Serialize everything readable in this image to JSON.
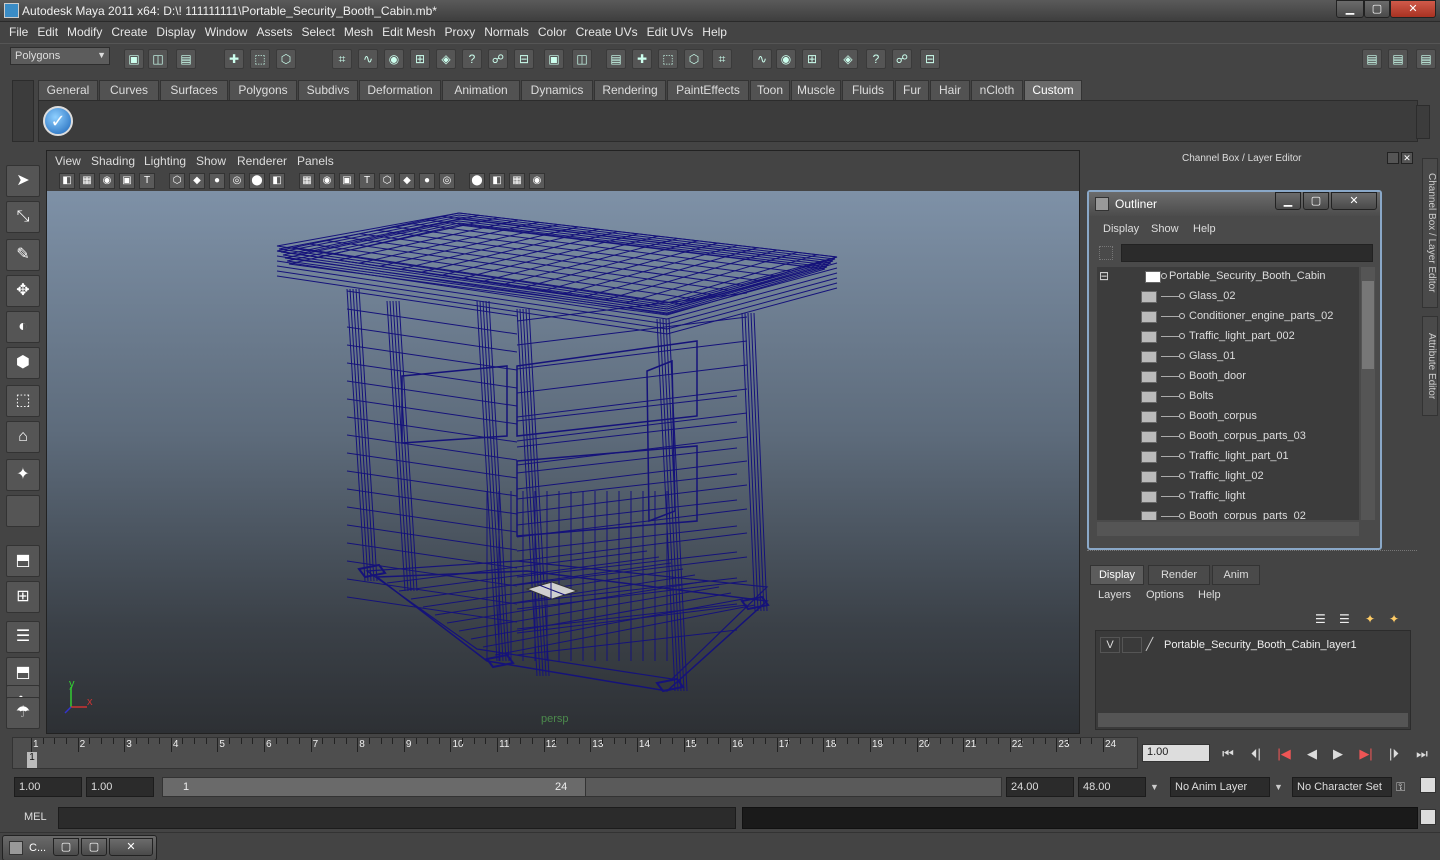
{
  "window": {
    "title": "Autodesk Maya 2011 x64: D:\\! 111111111\\Portable_Security_Booth_Cabin.mb*",
    "minimize": "▁",
    "maximize": "▢",
    "close": "✕"
  },
  "menubar": [
    "File",
    "Edit",
    "Modify",
    "Create",
    "Display",
    "Window",
    "Assets",
    "Select",
    "Mesh",
    "Edit Mesh",
    "Proxy",
    "Normals",
    "Color",
    "Create UVs",
    "Edit UVs",
    "Help"
  ],
  "statusline": {
    "mode": "Polygons"
  },
  "shelf": {
    "tabs": [
      "General",
      "Curves",
      "Surfaces",
      "Polygons",
      "Subdivs",
      "Deformation",
      "Animation",
      "Dynamics",
      "Rendering",
      "PaintEffects",
      "Toon",
      "Muscle",
      "Fluids",
      "Fur",
      "Hair",
      "nCloth",
      "Custom"
    ],
    "active_tab": "Custom",
    "shelf_icon": "checkmark-icon"
  },
  "viewport": {
    "menu": [
      "View",
      "Shading",
      "Lighting",
      "Show",
      "Renderer",
      "Panels"
    ],
    "camera_label": "persp",
    "axis_y": "y",
    "axis_x": "x",
    "wire_color": "#15127a"
  },
  "channel_box": {
    "title": "Channel Box / Layer Editor"
  },
  "side_tabs": [
    "Channel Box / Layer Editor",
    "Attribute Editor"
  ],
  "outliner": {
    "title": "Outliner",
    "menu": [
      "Display",
      "Show",
      "Help"
    ],
    "root": "Portable_Security_Booth_Cabin",
    "expand": "⊟",
    "children": [
      "Glass_02",
      "Conditioner_engine_parts_02",
      "Traffic_light_part_002",
      "Glass_01",
      "Booth_door",
      "Bolts",
      "Booth_corpus",
      "Booth_corpus_parts_03",
      "Traffic_light_part_01",
      "Traffic_light_02",
      "Traffic_light",
      "Booth_corpus_parts_02"
    ]
  },
  "layer_editor": {
    "tabs": [
      "Display",
      "Render",
      "Anim"
    ],
    "active_tab": "Display",
    "menu": [
      "Layers",
      "Options",
      "Help"
    ],
    "layer": {
      "visible": "V",
      "name": "Portable_Security_Booth_Cabin_layer1"
    }
  },
  "time_slider": {
    "start": 1,
    "end": 24,
    "ticks": [
      "1",
      "2",
      "3",
      "4",
      "5",
      "6",
      "7",
      "8",
      "9",
      "10",
      "11",
      "12",
      "13",
      "14",
      "15",
      "16",
      "17",
      "18",
      "19",
      "20",
      "21",
      "22",
      "23",
      "24"
    ],
    "current_frame_marker": "1",
    "current_frame": "1.00"
  },
  "playback": [
    "⏮",
    "⏴|",
    "|◀",
    "◀",
    "▶",
    "▶|",
    "|⏵",
    "⏭"
  ],
  "range_slider": {
    "start_time": "1.00",
    "playback_start": "1.00",
    "range_start": "1",
    "range_end": "24",
    "playback_end": "24.00",
    "end_time": "48.00",
    "anim_layer": "No Anim Layer",
    "character_set": "No Character Set"
  },
  "command_line": {
    "label": "MEL"
  },
  "minimized_window": {
    "label": "C..."
  }
}
